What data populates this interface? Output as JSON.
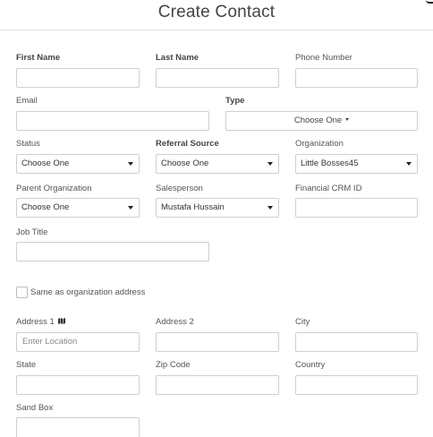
{
  "header": {
    "title": "Create Contact"
  },
  "fields": {
    "first_name": {
      "label": "First Name",
      "value": ""
    },
    "last_name": {
      "label": "Last Name",
      "value": ""
    },
    "phone": {
      "label": "Phone Number",
      "value": ""
    },
    "email": {
      "label": "Email",
      "value": ""
    },
    "type": {
      "label": "Type",
      "value": "Choose One"
    },
    "status": {
      "label": "Status",
      "value": "Choose One"
    },
    "referral_source": {
      "label": "Referral Source",
      "value": "Choose One"
    },
    "organization": {
      "label": "Organization",
      "value": "Little Bosses45"
    },
    "parent_organization": {
      "label": "Parent Organization",
      "value": "Choose One"
    },
    "salesperson": {
      "label": "Salesperson",
      "value": "Mustafa Hussain"
    },
    "financial_crm_id": {
      "label": "Financial CRM ID",
      "value": ""
    },
    "job_title": {
      "label": "Job Title",
      "value": ""
    },
    "same_as_org": {
      "label": "Same as organization address",
      "checked": false
    },
    "address1": {
      "label": "Address 1",
      "placeholder": "Enter Location",
      "icon": "map-icon"
    },
    "address2": {
      "label": "Address 2",
      "value": ""
    },
    "city": {
      "label": "City",
      "value": ""
    },
    "state": {
      "label": "State",
      "value": ""
    },
    "zip": {
      "label": "Zip Code",
      "value": ""
    },
    "country": {
      "label": "Country",
      "value": ""
    },
    "sandbox": {
      "label": "Sand Box",
      "value": ""
    }
  }
}
